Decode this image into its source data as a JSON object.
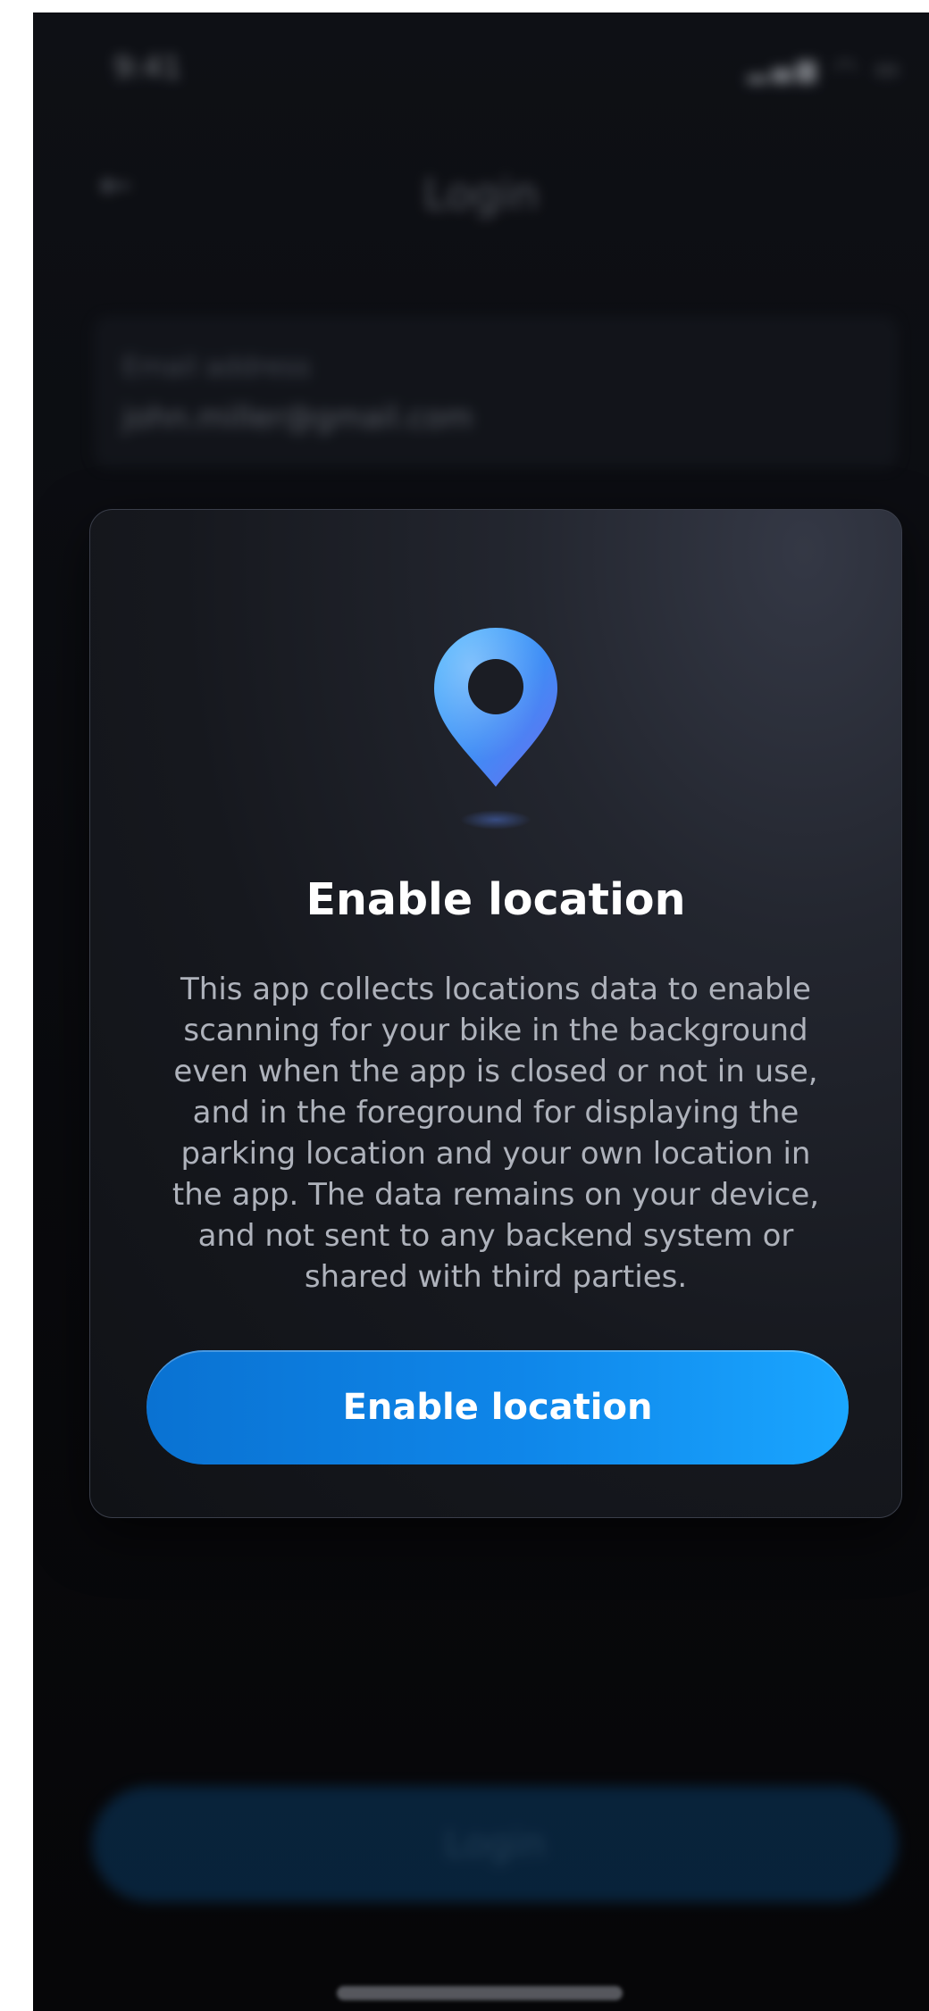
{
  "background": {
    "status_bar": {
      "time": "9:41",
      "icons": "▂▄▆ ◠ ▭"
    },
    "nav": {
      "back_glyph": "←",
      "title": "Login"
    },
    "email_card": {
      "label": "Email address",
      "value": "john.miller@gmail.com"
    },
    "login_button_label": "Login"
  },
  "modal": {
    "icon": "location-pin-icon",
    "title": "Enable location",
    "body": "This app collects locations data to enable scanning for your bike in the background even when the app is closed or not in use, and in the foreground for displaying the parking location and your own location in the app. The data remains on your device, and not sent to any backend system or shared with third parties.",
    "button_label": "Enable location"
  },
  "colors": {
    "accent": "#0f87ea",
    "background": "#0a0b0f",
    "modal": "#1c1f27"
  }
}
